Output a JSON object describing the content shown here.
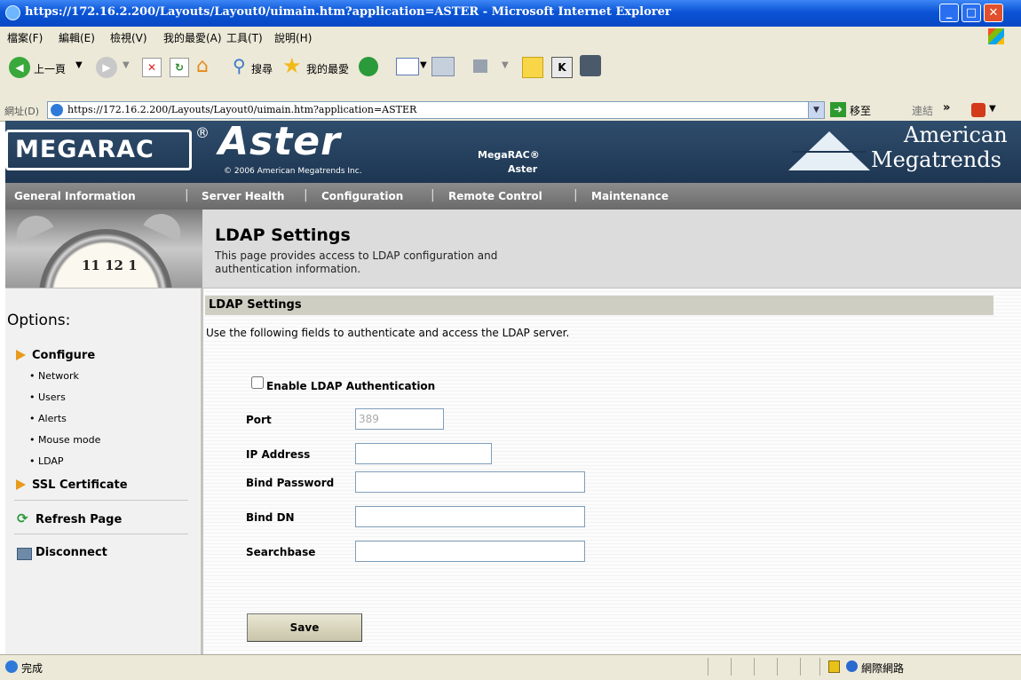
{
  "window": {
    "title": "https://172.16.2.200/Layouts/Layout0/uimain.htm?application=ASTER - Microsoft Internet Explorer"
  },
  "menu": [
    "檔案(F)",
    "編輯(E)",
    "檢視(V)",
    "我的最愛(A)",
    "工具(T)",
    "說明(H)"
  ],
  "toolbar": {
    "back_label": "上一頁",
    "search_label": "搜尋",
    "favorites_label": "我的最愛"
  },
  "address": {
    "label": "網址(D)",
    "url": "https://172.16.2.200/Layouts/Layout0/uimain.htm?application=ASTER",
    "go_label": "移至",
    "links_label": "連結"
  },
  "banner": {
    "brand": "MEGARAC",
    "registered": "®",
    "product": "Aster",
    "copyright": "© 2006 American Megatrends Inc.",
    "model_line1": "MegaRAC®",
    "model_line2": "Aster",
    "company_line1": "American",
    "company_line2": "Megatrends"
  },
  "nav": [
    "General Information",
    "Server Health",
    "Configuration",
    "Remote Control",
    "Maintenance"
  ],
  "page": {
    "title": "LDAP Settings",
    "description_line1": "This page provides access to LDAP configuration and",
    "description_line2": "authentication information.",
    "clock_numbers": "11 12 1"
  },
  "sidebar": {
    "heading": "Options:",
    "configure": "Configure",
    "sub_items": [
      "Network",
      "Users",
      "Alerts",
      "Mouse mode",
      "LDAP"
    ],
    "ssl": "SSL Certificate",
    "refresh": "Refresh Page",
    "disconnect": "Disconnect"
  },
  "form": {
    "section_title": "LDAP Settings",
    "intro": "Use the following fields to authenticate and access the LDAP server.",
    "enable_label": "Enable LDAP Authentication",
    "enable_checked": false,
    "port_label": "Port",
    "port_value": "389",
    "ip_label": "IP Address",
    "ip_value": "",
    "bindpw_label": "Bind Password",
    "bindpw_value": "",
    "binddn_label": "Bind DN",
    "binddn_value": "",
    "searchbase_label": "Searchbase",
    "searchbase_value": "",
    "save_label": "Save"
  },
  "status": {
    "text": "完成",
    "zone": "網際網路"
  },
  "colors": {
    "titlebar": "#0a54d6",
    "banner": "#2f4d6c",
    "navbar": "#7a7a7a",
    "section_bar": "#cfcec3",
    "accent_triangle": "#e89a1a"
  }
}
